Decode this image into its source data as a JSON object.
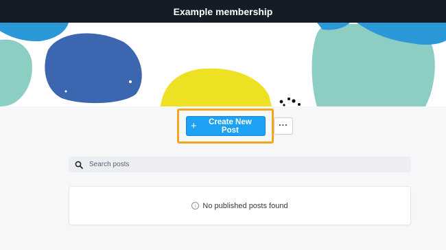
{
  "header": {
    "title": "Example membership"
  },
  "banner": {
    "colors": {
      "light_blue": "#2b98d8",
      "teal": "#8ccdc4",
      "dark_blue": "#3c66b0",
      "yellow": "#ece123",
      "black": "#111111"
    }
  },
  "actions": {
    "create_post_label": "Create New Post",
    "create_post_icon": "plus-icon",
    "more_label": "···",
    "highlight_color": "#f0a71f",
    "button_color": "#1da1f2"
  },
  "search": {
    "placeholder": "Search posts",
    "value": ""
  },
  "empty_state": {
    "message": "No published posts found",
    "icon": "info-icon",
    "icon_glyph": "i"
  }
}
